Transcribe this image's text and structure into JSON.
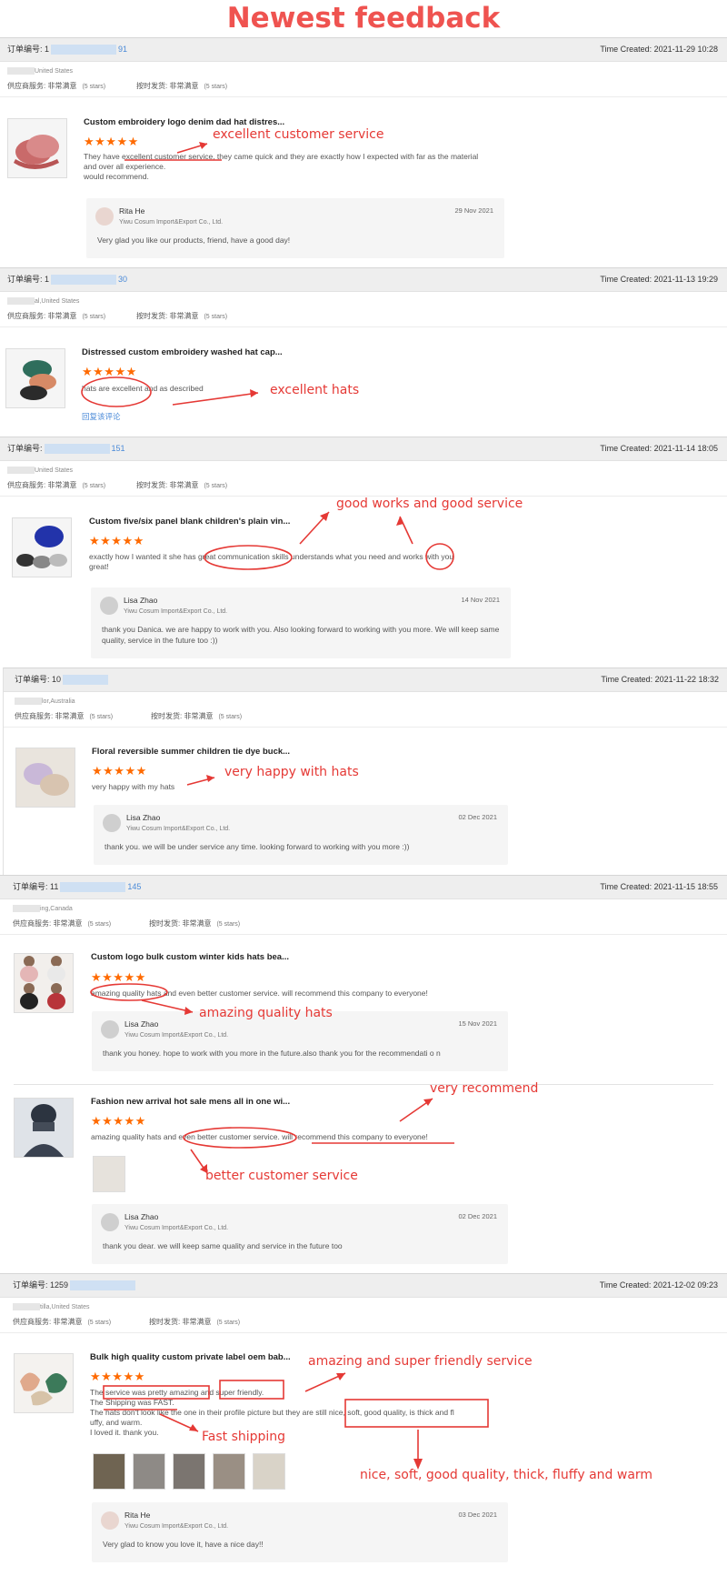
{
  "header": {
    "title": "Newest feedback"
  },
  "orders": [
    {
      "order_label": "订单编号: 1",
      "order_num_tail": "91",
      "time": "Time Created: 2021-11-29 10:28",
      "location": "United States",
      "service_rating": "供应商服务: 非常满意",
      "service_stars": "(5 stars)",
      "ship_rating": "按时发货: 非常满意",
      "ship_stars": "(5 stars)",
      "products": [
        {
          "name": "Custom embroidery logo denim dad hat distres...",
          "stars": "★★★★★",
          "comment": "They have excellent customer service, they came quick and they are exactly how I expected with far as the material and over all experience.",
          "comment2": "would recommend.",
          "reply": {
            "name": "Rita He",
            "company": "Yiwu Cosum Import&Export Co., Ltd.",
            "date": "29 Nov 2021",
            "message": "Very glad you like our products, friend, have a good day!"
          }
        }
      ]
    },
    {
      "order_label": "订单编号: 1",
      "order_num_tail": "30",
      "time": "Time Created: 2021-11-13 19:29",
      "location": "al,United States",
      "service_rating": "供应商服务: 非常满意",
      "service_stars": "(5 stars)",
      "ship_rating": "按时发货: 非常满意",
      "ship_stars": "(5 stars)",
      "products": [
        {
          "name": "Distressed custom embroidery washed hat cap...",
          "stars": "★★★★★",
          "comment": "hats are excellent and as described",
          "link": "回复该评论"
        }
      ]
    },
    {
      "order_label": "订单编号:",
      "order_num_tail": "151",
      "time": "Time Created: 2021-11-14 18:05",
      "location": "United States",
      "service_rating": "供应商服务: 非常满意",
      "service_stars": "(5 stars)",
      "ship_rating": "按时发货: 非常满意",
      "ship_stars": "(5 stars)",
      "products": [
        {
          "name": "Custom five/six panel blank children's plain vin...",
          "stars": "★★★★★",
          "comment": "exactly how I wanted it she has great communication skills understands what you need and works with you",
          "comment2": "great!",
          "reply": {
            "name": "Lisa Zhao",
            "company": "Yiwu Cosum Import&Export Co., Ltd.",
            "date": "14 Nov 2021",
            "message": "thank you Danica. we are happy to work with you. Also looking forward to working with you more. We will keep same quality, service in the future too :))"
          }
        }
      ]
    },
    {
      "order_label": "订单编号: 10",
      "order_num_tail": "",
      "time": "Time Created: 2021-11-22 18:32",
      "location": "lor,Australia",
      "service_rating": "供应商服务: 非常满意",
      "service_stars": "(5 stars)",
      "ship_rating": "按时发货: 非常满意",
      "ship_stars": "(5 stars)",
      "products": [
        {
          "name": "Floral reversible summer children tie dye buck...",
          "stars": "★★★★★",
          "comment": "very happy with my hats",
          "reply": {
            "name": "Lisa Zhao",
            "company": "Yiwu Cosum Import&Export Co., Ltd.",
            "date": "02 Dec 2021",
            "message": "thank you. we will be under service any time. looking forward to working with you more :))"
          }
        }
      ]
    },
    {
      "order_label": "订单编号: 11",
      "order_num_tail": "145",
      "time": "Time Created: 2021-11-15 18:55",
      "location": "ing,Canada",
      "service_rating": "供应商服务: 非常满意",
      "service_stars": "(5 stars)",
      "ship_rating": "按时发货: 非常满意",
      "ship_stars": "(5 stars)",
      "products": [
        {
          "name": "Custom logo bulk custom winter kids hats bea...",
          "stars": "★★★★★",
          "comment": "amazing quality hats and even better customer service. will recommend this company to everyone!",
          "reply": {
            "name": "Lisa Zhao",
            "company": "Yiwu Cosum Import&Export Co., Ltd.",
            "date": "15 Nov 2021",
            "message": "thank you honey. hope to work with you more in the future.also thank you for the recommendati o n"
          }
        },
        {
          "name": "Fashion new arrival hot sale mens all in one wi...",
          "stars": "★★★★★",
          "comment": "amazing quality hats and even better customer service. will recommend this company to everyone!",
          "reply": {
            "name": "Lisa Zhao",
            "company": "Yiwu Cosum Import&Export Co., Ltd.",
            "date": "02 Dec 2021",
            "message": "thank you dear. we will keep same quality and service in the future too"
          }
        }
      ]
    },
    {
      "order_label": "订单编号: 1259",
      "order_num_tail": "",
      "time": "Time Created: 2021-12-02 09:23",
      "location": "tilla,United States",
      "service_rating": "供应商服务: 非常满意",
      "service_stars": "(5 stars)",
      "ship_rating": "按时发货: 非常满意",
      "ship_stars": "(5 stars)",
      "products": [
        {
          "name": "Bulk high quality custom private label oem bab...",
          "stars": "★★★★★",
          "comment_lines": [
            "The service was pretty amazing and super friendly.",
            "The Shipping was FAST.",
            "The hats don't look like the one in their profile picture but they are still nice, soft, good quality, is thick and fl",
            "uffy, and warm.",
            "I loved it. thank you."
          ],
          "reply": {
            "name": "Rita He",
            "company": "Yiwu Cosum Import&Export Co., Ltd.",
            "date": "03 Dec 2021",
            "message": "Very glad to know you love it, have a nice day!!"
          }
        }
      ]
    }
  ],
  "annotations": {
    "a1": "excellent customer service",
    "a2": "excellent hats",
    "a3": "good works and good service",
    "a4": "very happy with hats",
    "a5": "amazing quality hats",
    "a6": "very recommend",
    "a7": "better customer service",
    "a8": "amazing and super friendly service",
    "a9": "Fast shipping",
    "a10": "nice, soft, good quality, thick, fluffy and warm"
  },
  "colors": {
    "annotation": "#e53935",
    "stars": "#ff6a00",
    "link": "#4a8ad8",
    "bar": "#eeeeee"
  }
}
